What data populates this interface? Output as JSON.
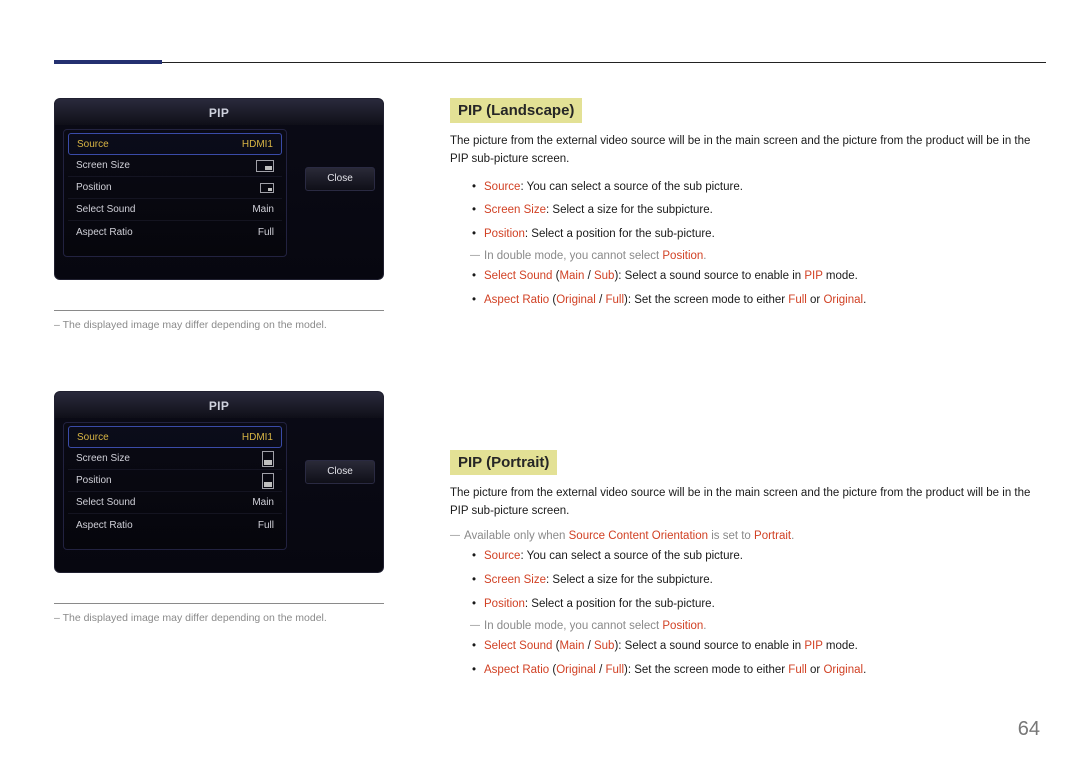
{
  "page_number": "64",
  "panel": {
    "title": "PIP",
    "menu": [
      {
        "label": "Source",
        "value": "HDMI1",
        "selected": true,
        "icon": null
      },
      {
        "label": "Screen Size",
        "value": "",
        "icon": "screen-size"
      },
      {
        "label": "Position",
        "value": "",
        "icon": "position"
      },
      {
        "label": "Select Sound",
        "value": "Main",
        "icon": null
      },
      {
        "label": "Aspect Ratio",
        "value": "Full",
        "icon": null
      }
    ],
    "close": "Close",
    "footnote_prefix": "–  ",
    "footnote": "The displayed image may differ depending on the model."
  },
  "landscape": {
    "heading": "PIP (Landscape)",
    "intro": "The picture from the external video source will be in the main screen and the picture from the product will be in the PIP sub-picture screen.",
    "b_source_key": "Source",
    "b_source_rest": ": You can select a source of the sub picture.",
    "b_size_key": "Screen Size",
    "b_size_rest": ": Select a size for the subpicture.",
    "b_pos_key": "Position",
    "b_pos_rest": ": Select a position for the sub-picture.",
    "note_dbl_pre": "In double mode, you cannot select ",
    "note_dbl_key": "Position",
    "note_dbl_post": ".",
    "b_sound_key": "Select Sound",
    "b_sound_paren_open": " (",
    "b_sound_main": "Main",
    "b_sound_sep": " / ",
    "b_sound_sub": "Sub",
    "b_sound_paren_close": ")",
    "b_sound_rest": ": Select a sound source to enable in ",
    "b_sound_pip": "PIP",
    "b_sound_tail": " mode.",
    "b_ar_key": "Aspect Ratio",
    "b_ar_paren_open": " (",
    "b_ar_orig": "Original",
    "b_ar_sep": " / ",
    "b_ar_full": "Full",
    "b_ar_paren_close": ")",
    "b_ar_rest": ": Set the screen mode to either ",
    "b_ar_full2": "Full",
    "b_ar_or": " or ",
    "b_ar_orig2": "Original",
    "b_ar_tail": "."
  },
  "portrait": {
    "heading": "PIP (Portrait)",
    "intro": "The picture from the external video source will be in the main screen and the picture from the product will be in the PIP sub-picture screen.",
    "avail_pre": "Available only when ",
    "avail_key": "Source Content Orientation",
    "avail_mid": " is set to ",
    "avail_val": "Portrait",
    "avail_post": "."
  }
}
